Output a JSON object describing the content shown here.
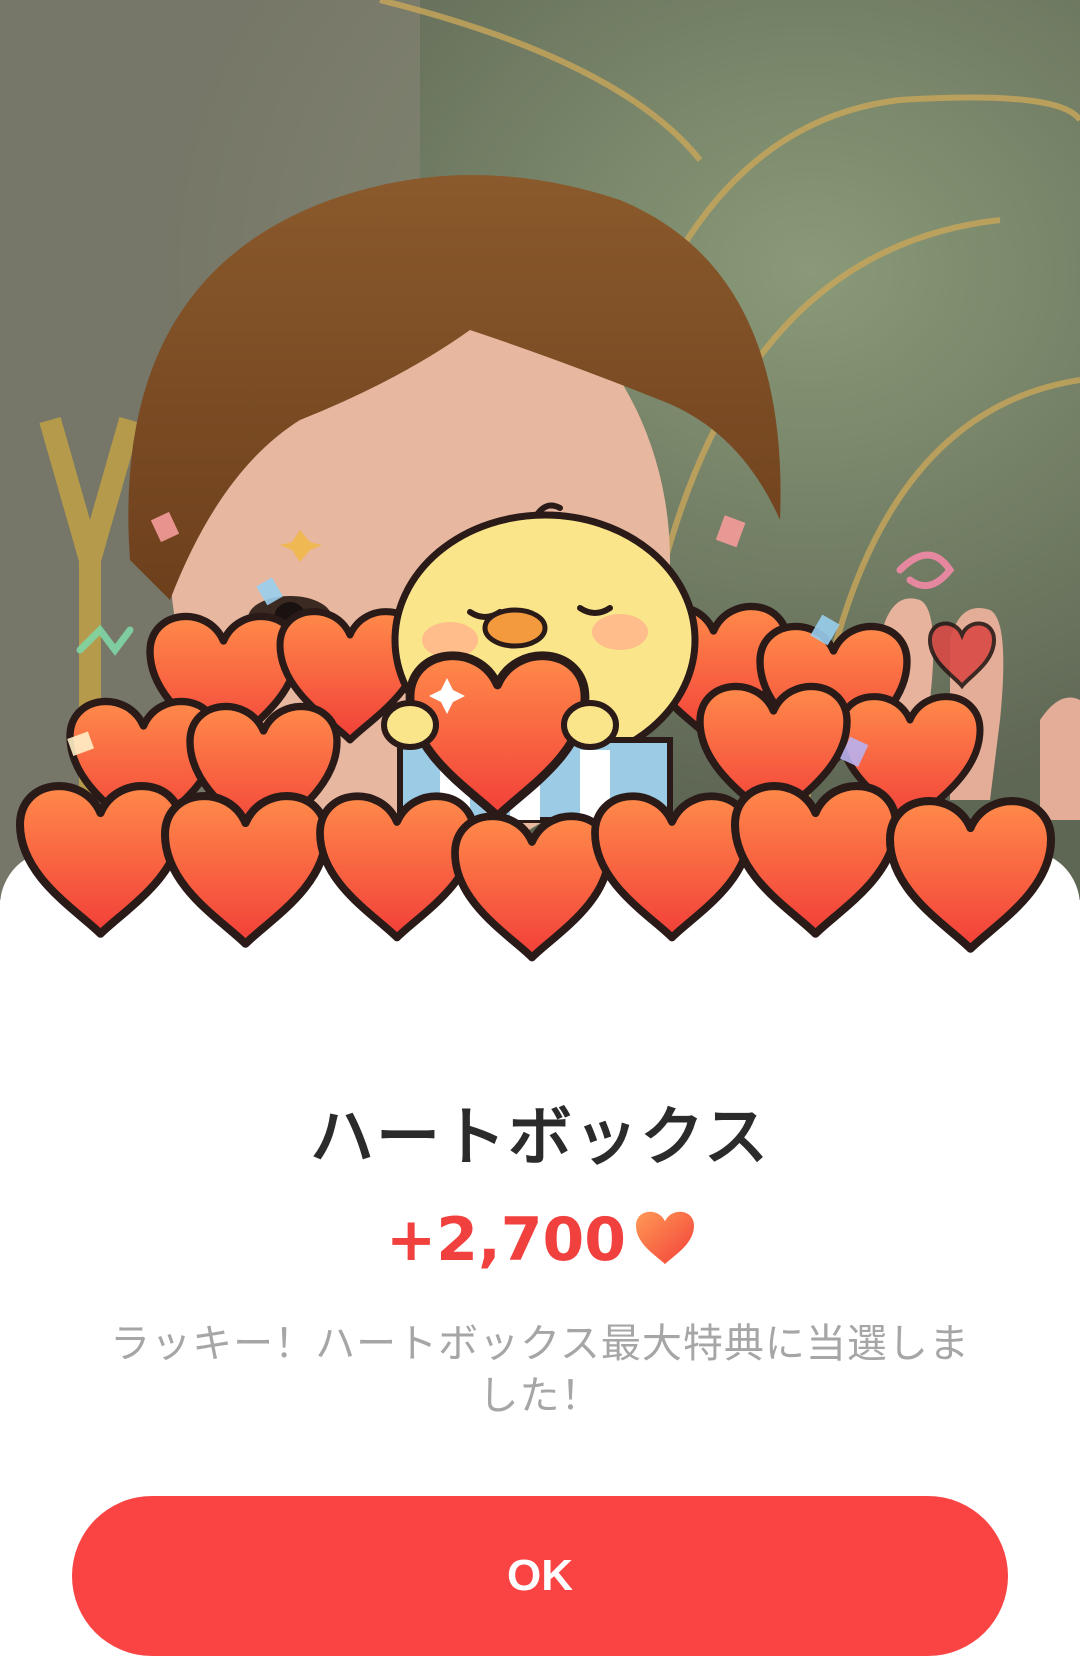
{
  "popup": {
    "title": "ハートボックス",
    "amount": "+2,700",
    "amount_icon": "heart-icon",
    "message": "ラッキー！ハートボックス最大特典に当選しました！",
    "ok_label": "OK"
  },
  "colors": {
    "accent": "#fa4444",
    "amount_text": "#f0413e",
    "title_text": "#2b2b2b",
    "message_text": "#a6a6a6",
    "heart_fill": "#f4563f"
  },
  "illustration": {
    "subject": "yellow-chick-character",
    "items": "heart-pile"
  }
}
